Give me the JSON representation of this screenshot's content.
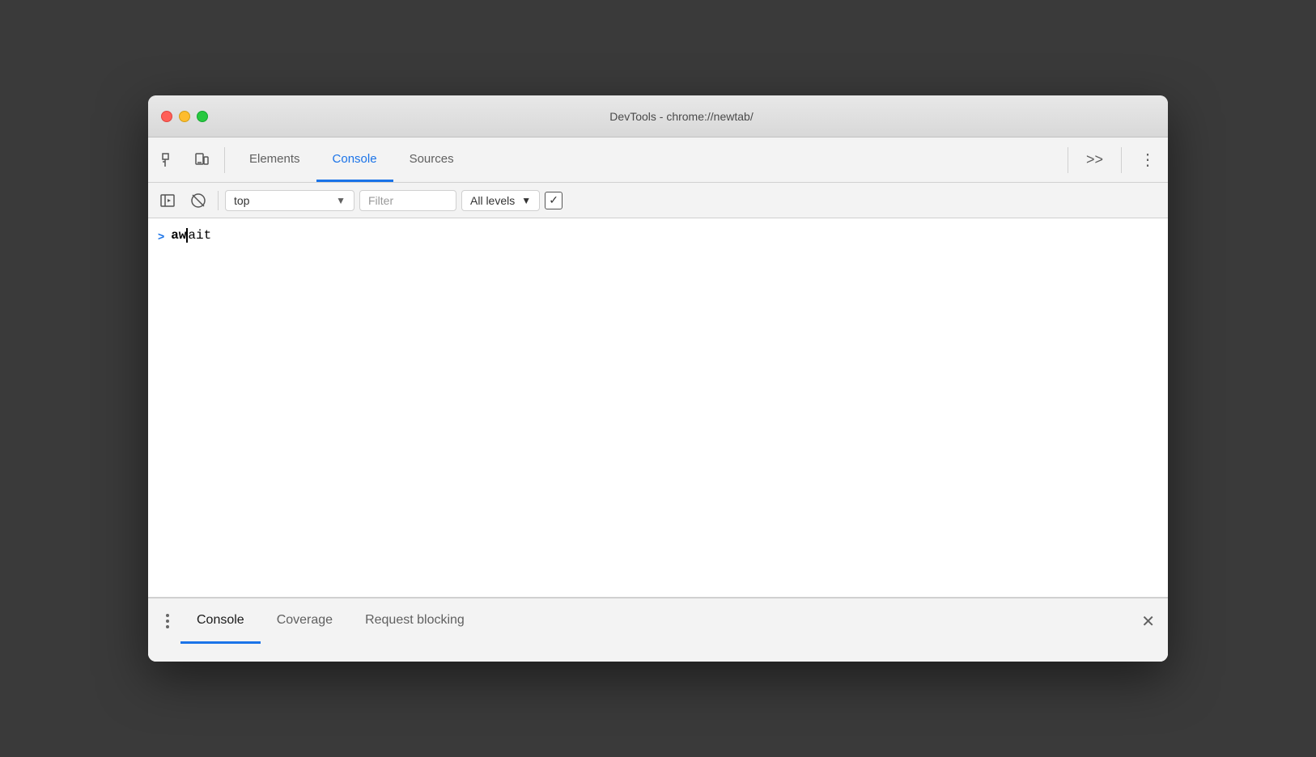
{
  "window": {
    "title": "DevTools - chrome://newtab/"
  },
  "toolbar": {
    "inspect_label": "Inspect",
    "device_label": "Device",
    "tabs": [
      {
        "id": "elements",
        "label": "Elements",
        "active": false
      },
      {
        "id": "console",
        "label": "Console",
        "active": true
      },
      {
        "id": "sources",
        "label": "Sources",
        "active": false
      }
    ],
    "more_tabs_label": ">>",
    "menu_label": "⋮"
  },
  "console_toolbar": {
    "context": "top",
    "filter_placeholder": "Filter",
    "levels_label": "All levels",
    "has_checkbox": true
  },
  "console": {
    "entry": {
      "chevron": ">",
      "text_bold": "aw",
      "text_normal": "ait"
    }
  },
  "drawer": {
    "tabs": [
      {
        "id": "console",
        "label": "Console",
        "active": true
      },
      {
        "id": "coverage",
        "label": "Coverage",
        "active": false
      },
      {
        "id": "request-blocking",
        "label": "Request blocking",
        "active": false
      }
    ],
    "close_label": "✕"
  }
}
